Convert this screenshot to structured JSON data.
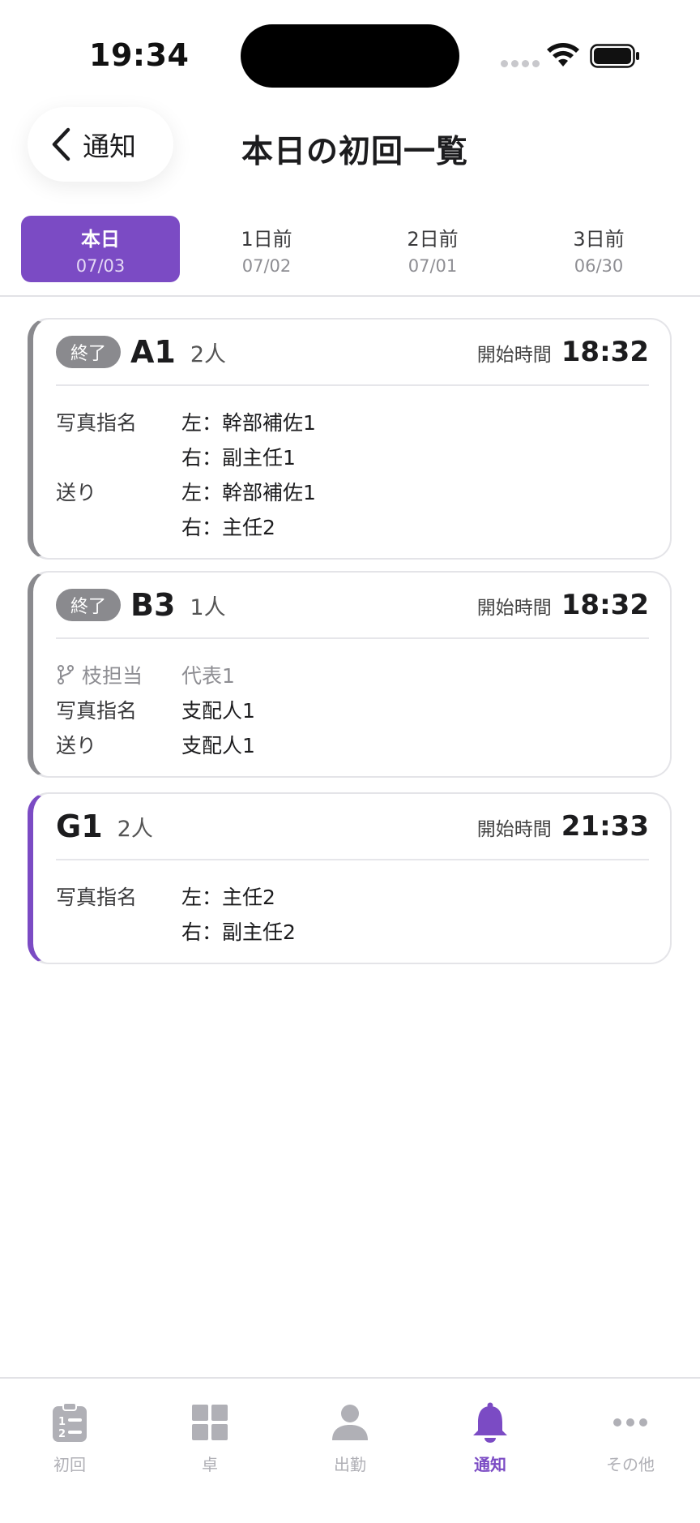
{
  "status_bar": {
    "time": "19:34"
  },
  "header": {
    "back_label": "通知",
    "title": "本日の初回一覧"
  },
  "tabs": [
    {
      "label": "本日",
      "date": "07/03",
      "active": true
    },
    {
      "label": "1日前",
      "date": "07/02",
      "active": false
    },
    {
      "label": "2日前",
      "date": "07/01",
      "active": false
    },
    {
      "label": "3日前",
      "date": "06/30",
      "active": false
    }
  ],
  "cards": [
    {
      "status": "終了",
      "table": "A1",
      "people": "2人",
      "start_label": "開始時間",
      "start_time": "18:32",
      "rows": [
        {
          "key": "写真指名",
          "value": "左：幹部補佐1"
        },
        {
          "key": "",
          "value": "右：副主任1"
        },
        {
          "key": "送り",
          "value": "左：幹部補佐1"
        },
        {
          "key": "",
          "value": "右：主任2"
        }
      ]
    },
    {
      "status": "終了",
      "table": "B3",
      "people": "1人",
      "start_label": "開始時間",
      "start_time": "18:32",
      "branch": {
        "key": "枝担当",
        "value": "代表1"
      },
      "rows": [
        {
          "key": "写真指名",
          "value": "支配人1"
        },
        {
          "key": "送り",
          "value": "支配人1"
        }
      ]
    },
    {
      "table": "G1",
      "people": "2人",
      "start_label": "開始時間",
      "start_time": "21:33",
      "rows": [
        {
          "key": "写真指名",
          "value": "左：主任2"
        },
        {
          "key": "",
          "value": "右：副主任2"
        }
      ]
    }
  ],
  "bottom_nav": [
    {
      "label": "初回",
      "icon": "clipboard-list-icon"
    },
    {
      "label": "卓",
      "icon": "grid-icon"
    },
    {
      "label": "出勤",
      "icon": "person-icon"
    },
    {
      "label": "通知",
      "icon": "bell-icon",
      "active": true
    },
    {
      "label": "その他",
      "icon": "more-dots-icon"
    }
  ],
  "colors": {
    "accent": "#7b4bc4",
    "finished_badge": "#8a8a8e",
    "inactive_nav": "#b0b0b6"
  }
}
